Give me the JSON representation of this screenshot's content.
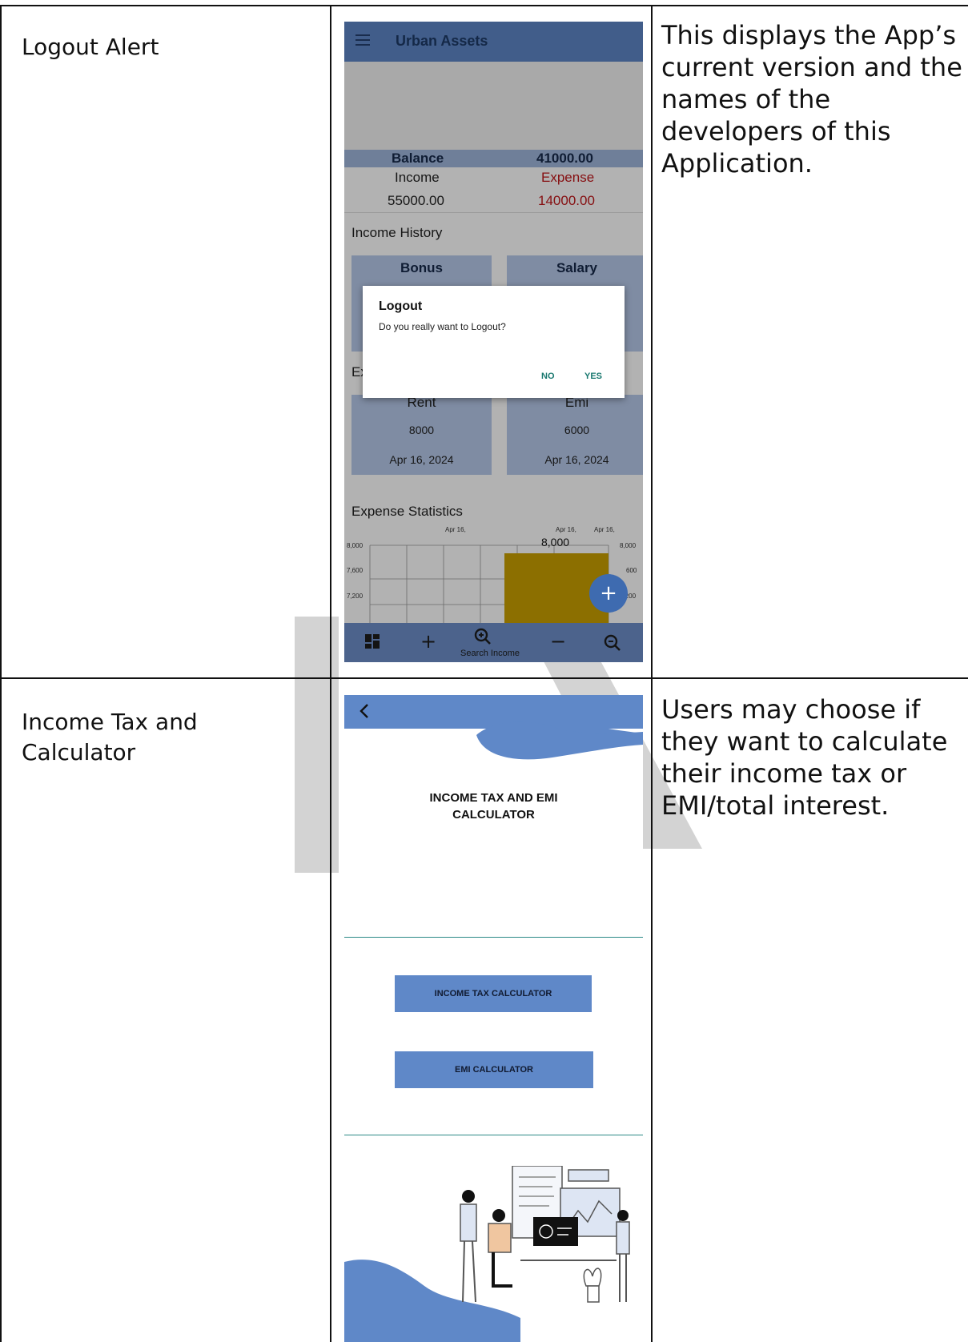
{
  "rows": [
    {
      "label": "Logout Alert",
      "description": "This displays the App’s current version and the names of the developers of this Application."
    },
    {
      "label": "Income Tax and Calculator",
      "description": "Users may choose if they want to calculate their income tax or EMI/total interest."
    }
  ],
  "screen1": {
    "app_title": "Urban Assets",
    "balance_label": "Balance",
    "balance_value": "41000.00",
    "income_label": "Income",
    "expense_label": "Expense",
    "income_value": "55000.00",
    "expense_value": "14000.00",
    "income_history_title": "Income History",
    "income_cards": [
      "Bonus",
      "Salary"
    ],
    "expense_history_partial": "Ex",
    "expense_cards": [
      {
        "name": "Rent",
        "amount": "8000",
        "date": "Apr 16, 2024"
      },
      {
        "name": "Emi",
        "amount": "6000",
        "date": "Apr 16, 2024"
      }
    ],
    "stats_title": "Expense Statistics",
    "chart_top_labels": [
      "Apr 16,",
      "Apr 16,",
      "Apr 16,"
    ],
    "chart_value_label": "8,000",
    "chart_left_ticks": [
      "8,000",
      "7,600",
      "7,200"
    ],
    "chart_right_ticks": [
      "8,000",
      "600",
      "7,200"
    ],
    "dialog": {
      "title": "Logout",
      "message": "Do you really want to Logout?",
      "no_label": "NO",
      "yes_label": "YES"
    },
    "fab_label": "+",
    "nav": {
      "dashboard_icon": "dashboard-icon",
      "add_icon": "+",
      "search_label": "Search Income",
      "minus_icon": "−",
      "search_expense_icon": "search-minus-icon"
    }
  },
  "screen2": {
    "title_line1": "INCOME TAX AND EMI",
    "title_line2": "CALCULATOR",
    "income_tax_button": "INCOME TAX CALCULATOR",
    "emi_button": "EMI CALCULATOR"
  },
  "colors": {
    "app_blue": "#5f88c8",
    "accent_teal": "#19786f",
    "expense_red": "#c0171b",
    "chart_yellow": "#c9a000"
  }
}
